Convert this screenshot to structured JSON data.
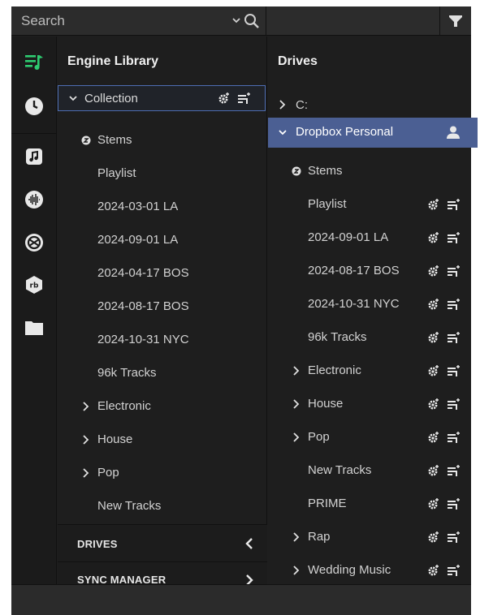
{
  "search": {
    "placeholder": "Search"
  },
  "rail": {
    "items": [
      {
        "icon": "playlist-icon",
        "active": true
      },
      {
        "icon": "history-icon"
      },
      {
        "icon": "music-note-icon"
      },
      {
        "icon": "serato-icon"
      },
      {
        "icon": "traktor-icon"
      },
      {
        "icon": "rekordbox-icon"
      },
      {
        "icon": "folder-icon"
      }
    ]
  },
  "library": {
    "title": "Engine Library",
    "collection_label": "Collection",
    "items": [
      {
        "label": "Stems",
        "kind": "stems"
      },
      {
        "label": "Playlist"
      },
      {
        "label": "2024-03-01 LA"
      },
      {
        "label": "2024-09-01 LA"
      },
      {
        "label": "2024-04-17 BOS"
      },
      {
        "label": "2024-08-17 BOS"
      },
      {
        "label": "2024-10-31 NYC"
      },
      {
        "label": "96k Tracks"
      },
      {
        "label": "Electronic",
        "expandable": true
      },
      {
        "label": "House",
        "expandable": true
      },
      {
        "label": "Pop",
        "expandable": true
      },
      {
        "label": "New Tracks"
      }
    ],
    "drives_section": "DRIVES",
    "sync_section": "SYNC MANAGER"
  },
  "drives": {
    "title": "Drives",
    "c_drive": "C:",
    "dropbox_label": "Dropbox Personal",
    "items": [
      {
        "label": "Stems",
        "kind": "stems"
      },
      {
        "label": "Playlist",
        "actions": true
      },
      {
        "label": "2024-09-01 LA",
        "actions": true
      },
      {
        "label": "2024-08-17 BOS",
        "actions": true
      },
      {
        "label": "2024-10-31 NYC",
        "actions": true
      },
      {
        "label": "96k Tracks",
        "actions": true
      },
      {
        "label": "Electronic",
        "expandable": true,
        "actions": true
      },
      {
        "label": "House",
        "expandable": true,
        "actions": true
      },
      {
        "label": "Pop",
        "expandable": true,
        "actions": true
      },
      {
        "label": "New Tracks",
        "actions": true
      },
      {
        "label": "PRIME",
        "actions": true
      },
      {
        "label": "Rap",
        "expandable": true,
        "actions": true
      },
      {
        "label": "Wedding Music",
        "expandable": true,
        "actions": true
      }
    ]
  },
  "colors": {
    "accent_green": "#2ecc71",
    "selection_blue": "#4b5f93",
    "collection_border": "#4e6db3"
  }
}
